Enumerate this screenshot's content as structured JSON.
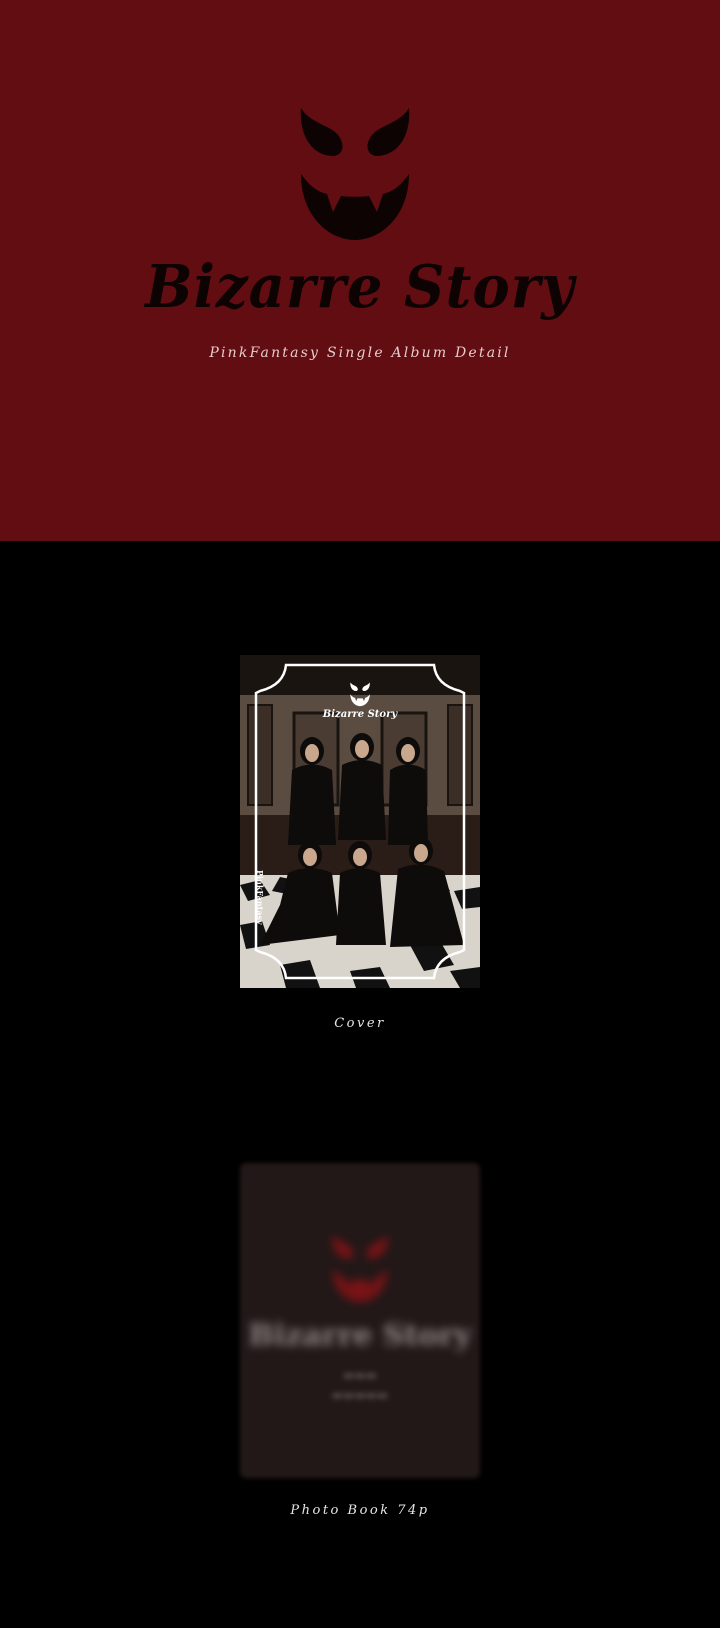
{
  "hero": {
    "title": "Bizarre Story",
    "subtitle": "PinkFantasy Single Album Detail",
    "background": "#620d12",
    "logo_icon": "devil-face-icon"
  },
  "cover": {
    "caption": "Cover",
    "logo_text": "Bizarre Story",
    "artist_text": "PinkFantasy",
    "frame_color": "#ffffff"
  },
  "photobook": {
    "caption": "Photo Book 74p",
    "title": "Bizarre Story"
  }
}
